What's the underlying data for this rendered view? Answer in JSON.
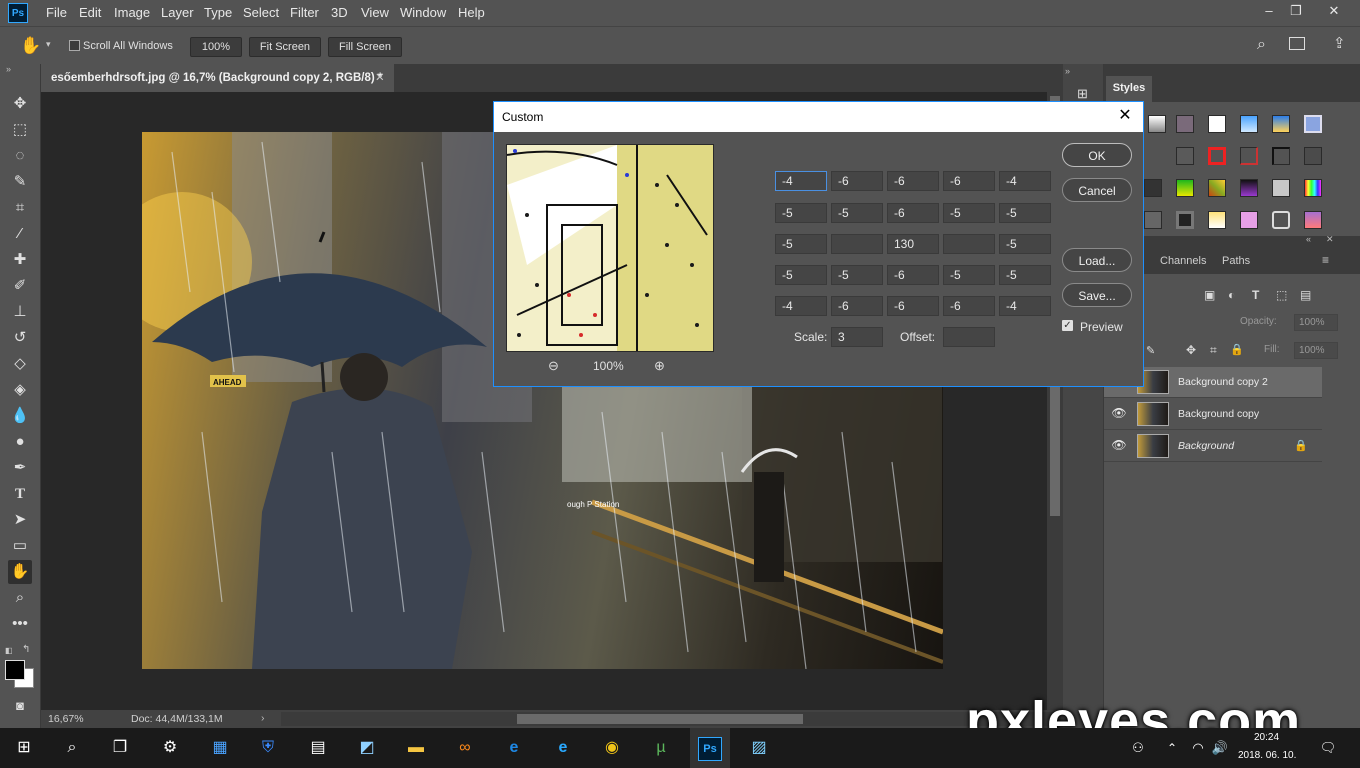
{
  "app": {
    "logo": "Ps"
  },
  "menu": [
    "File",
    "Edit",
    "Image",
    "Layer",
    "Type",
    "Select",
    "Filter",
    "3D",
    "View",
    "Window",
    "Help"
  ],
  "options": {
    "scroll_all": "Scroll All Windows",
    "zoom": "100%",
    "fit": "Fit Screen",
    "fill": "Fill Screen"
  },
  "document": {
    "tab_title": "esőemberhdrsoft.jpg @ 16,7% (Background copy 2, RGB/8) *",
    "zoom_status": "16,67%",
    "doc_status": "Doc: 44,4M/133,1M"
  },
  "dialog": {
    "title": "Custom",
    "matrix": [
      [
        "-4",
        "-6",
        "-6",
        "-6",
        "-4"
      ],
      [
        "-5",
        "-5",
        "-6",
        "-5",
        "-5"
      ],
      [
        "-5",
        "",
        "130",
        "",
        "-5"
      ],
      [
        "-5",
        "-5",
        "-6",
        "-5",
        "-5"
      ],
      [
        "-4",
        "-6",
        "-6",
        "-6",
        "-4"
      ]
    ],
    "scale_label": "Scale:",
    "scale_value": "3",
    "offset_label": "Offset:",
    "offset_value": "",
    "preview_zoom": "100%",
    "ok": "OK",
    "cancel": "Cancel",
    "load": "Load...",
    "save": "Save...",
    "preview_label": "Preview"
  },
  "panels": {
    "styles_tab": "Styles",
    "channels_tab": "Channels",
    "paths_tab": "Paths",
    "opacity_label": "Opacity:",
    "opacity_value": "100%",
    "fill_label": "Fill:",
    "fill_value": "100%",
    "layers": [
      "Background copy 2",
      "Background copy",
      "Background"
    ]
  },
  "taskbar": {
    "time": "20:24",
    "date": "2018. 06. 10."
  },
  "watermark": "pxleyes.com",
  "photo": {
    "sign1": "AHEAD",
    "sign2": "ough P  Station"
  }
}
